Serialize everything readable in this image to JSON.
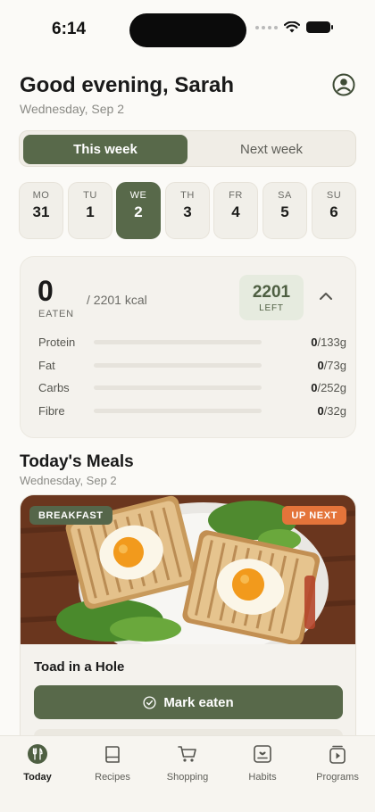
{
  "status_bar": {
    "time": "6:14"
  },
  "header": {
    "greeting": "Good evening, Sarah",
    "date": "Wednesday, Sep 2"
  },
  "week_toggle": {
    "options": [
      "This week",
      "Next week"
    ],
    "selected": "This week"
  },
  "days": [
    {
      "name": "MO",
      "num": "31",
      "selected": false
    },
    {
      "name": "TU",
      "num": "1",
      "selected": false
    },
    {
      "name": "WE",
      "num": "2",
      "selected": true
    },
    {
      "name": "TH",
      "num": "3",
      "selected": false
    },
    {
      "name": "FR",
      "num": "4",
      "selected": false
    },
    {
      "name": "SA",
      "num": "5",
      "selected": false
    },
    {
      "name": "SU",
      "num": "6",
      "selected": false
    }
  ],
  "summary": {
    "eaten_value": "0",
    "eaten_label": "EATEN",
    "total": "/ 2201 kcal",
    "left_value": "2201",
    "left_label": "LEFT",
    "macros": [
      {
        "name": "Protein",
        "current": "0",
        "target": "/133g",
        "progress": 0
      },
      {
        "name": "Fat",
        "current": "0",
        "target": "/73g",
        "progress": 0
      },
      {
        "name": "Carbs",
        "current": "0",
        "target": "/252g",
        "progress": 0
      },
      {
        "name": "Fibre",
        "current": "0",
        "target": "/32g",
        "progress": 0
      }
    ]
  },
  "meals": {
    "title": "Today's Meals",
    "date": "Wednesday, Sep 2",
    "card": {
      "tag": "BREAKFAST",
      "status": "UP NEXT",
      "name": "Toad in a Hole",
      "action": "Mark eaten"
    }
  },
  "tabbar": {
    "items": [
      {
        "label": "Today",
        "icon": "fork-knife-icon",
        "active": true
      },
      {
        "label": "Recipes",
        "icon": "book-icon",
        "active": false
      },
      {
        "label": "Shopping",
        "icon": "cart-icon",
        "active": false
      },
      {
        "label": "Habits",
        "icon": "heart-list-icon",
        "active": false
      },
      {
        "label": "Programs",
        "icon": "play-stack-icon",
        "active": false
      }
    ]
  },
  "colors": {
    "accent": "#58694a",
    "up_next": "#e4743a",
    "background": "#fbfaf7"
  }
}
